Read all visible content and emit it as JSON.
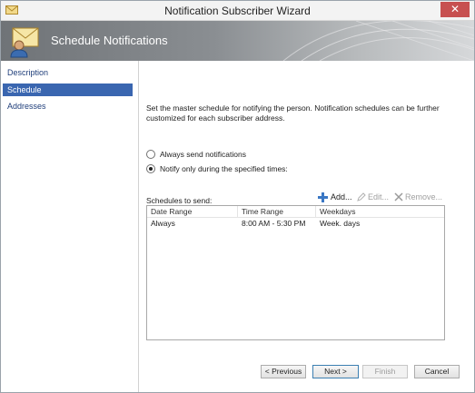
{
  "window": {
    "title": "Notification Subscriber Wizard",
    "close_glyph": "✕"
  },
  "banner": {
    "title": "Schedule Notifications"
  },
  "sidebar": {
    "items": [
      {
        "label": "Description",
        "active": false
      },
      {
        "label": "Schedule",
        "active": true
      },
      {
        "label": "Addresses",
        "active": false
      }
    ]
  },
  "main": {
    "description": "Set the master schedule for notifying the person. Notification schedules can be further customized for each subscriber address.",
    "radios": [
      {
        "label": "Always send notifications",
        "selected": false
      },
      {
        "label": "Notify only during the specified times:",
        "selected": true
      }
    ],
    "schedules_label": "Schedules to send:",
    "toolbar": {
      "add": "Add...",
      "edit": "Edit...",
      "remove": "Remove..."
    },
    "table": {
      "columns": [
        "Date Range",
        "Time Range",
        "Weekdays"
      ],
      "rows": [
        [
          "Always",
          "8:00 AM - 5:30 PM",
          "Week. days"
        ]
      ]
    }
  },
  "footer": {
    "previous": "< Previous",
    "next": "Next >",
    "finish": "Finish",
    "cancel": "Cancel"
  },
  "colors": {
    "accent": "#3a66b0",
    "close": "#c75050"
  }
}
